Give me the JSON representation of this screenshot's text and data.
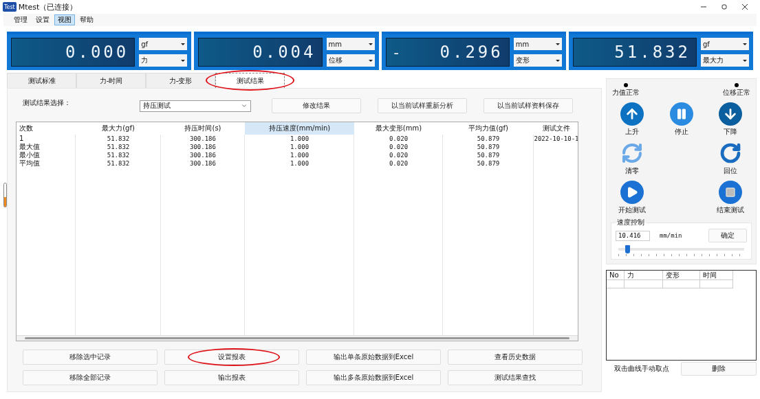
{
  "window": {
    "app_icon": "Test",
    "title": "Mtest（已连接）"
  },
  "menu": [
    {
      "label": "管理",
      "selected": false
    },
    {
      "label": "设置",
      "selected": false
    },
    {
      "label": "视图",
      "selected": true
    },
    {
      "label": "帮助",
      "selected": false
    }
  ],
  "displays": [
    {
      "value": "0.000",
      "unit": "gf",
      "quantity": "力"
    },
    {
      "value": "0.004",
      "unit": "mm",
      "quantity": "位移"
    },
    {
      "sign": "-",
      "value": "0.296",
      "unit": "mm",
      "quantity": "变形"
    },
    {
      "value": "51.832",
      "unit": "gf",
      "quantity": "最大力"
    }
  ],
  "tabs": [
    {
      "label": "测试标准",
      "selected": false,
      "circled": false
    },
    {
      "label": "力-时间",
      "selected": false,
      "circled": false
    },
    {
      "label": "力-变形",
      "selected": false,
      "circled": false
    },
    {
      "label": "测试结果",
      "selected": true,
      "circled": true
    }
  ],
  "result_select": {
    "label": "测试结果选择：",
    "value": "持压测试"
  },
  "top_buttons": [
    "修改结果",
    "以当前试样重新分析",
    "以当前试样资料保存"
  ],
  "table": {
    "columns": [
      {
        "label": "次数",
        "highlighted": false
      },
      {
        "label": "最大力(gf)",
        "highlighted": false
      },
      {
        "label": "持压时间(s)",
        "highlighted": false
      },
      {
        "label": "持压速度(mm/min)",
        "highlighted": true
      },
      {
        "label": "最大变形(mm)",
        "highlighted": false
      },
      {
        "label": "平均力值(gf)",
        "highlighted": false
      },
      {
        "label": "测试文件",
        "highlighted": false
      }
    ],
    "rows": [
      [
        "1",
        "51.832",
        "300.186",
        "1.000",
        "0.020",
        "50.879",
        "2022-10-10-1"
      ],
      [
        "最大值",
        "51.832",
        "300.186",
        "1.000",
        "0.020",
        "50.879",
        ""
      ],
      [
        "最小值",
        "51.832",
        "300.186",
        "1.000",
        "0.020",
        "50.879",
        ""
      ],
      [
        "平均值",
        "51.832",
        "300.186",
        "1.000",
        "0.020",
        "50.879",
        ""
      ]
    ]
  },
  "bottom_buttons": [
    {
      "label": "移除选中记录",
      "circled": false
    },
    {
      "label": "设置报表",
      "circled": true
    },
    {
      "label": "输出单条原始数据到Excel",
      "circled": false
    },
    {
      "label": "查看历史数据",
      "circled": false
    },
    {
      "label": "移除全部记录",
      "circled": false
    },
    {
      "label": "输出报表",
      "circled": false
    },
    {
      "label": "输出多条原始数据到Excel",
      "circled": false
    },
    {
      "label": "测试结果查找",
      "circled": false
    }
  ],
  "status": [
    "力值正常",
    "位移正常"
  ],
  "action_rows": [
    [
      {
        "kind": "up",
        "label": "上升"
      },
      {
        "kind": "pause",
        "label": "停止"
      },
      {
        "kind": "down",
        "label": "下降"
      }
    ],
    [
      {
        "kind": "zero",
        "label": "清零"
      },
      {
        "kind": "home",
        "label": "回位"
      }
    ],
    [
      {
        "kind": "start",
        "label": "开始测试"
      },
      {
        "kind": "stop",
        "label": "结束测试"
      }
    ]
  ],
  "speed_control": {
    "title": "速度控制",
    "value": "10.416",
    "unit": "mm/min",
    "confirm": "确定",
    "level": 0.07
  },
  "points_table": {
    "columns": [
      "No",
      "力",
      "变形",
      "时间"
    ]
  },
  "hint": "双击曲线手动取点",
  "delete_button": "删除"
}
